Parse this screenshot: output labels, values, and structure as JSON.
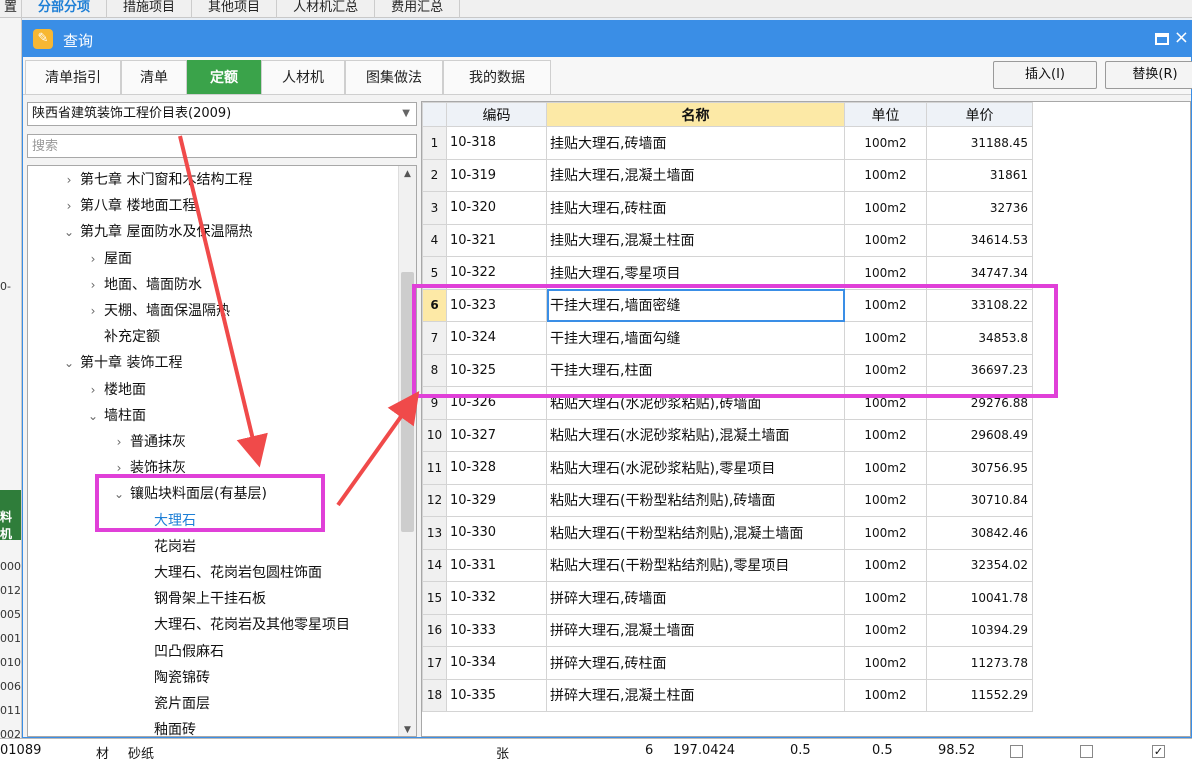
{
  "background": {
    "tabs": [
      "置",
      "分部分项",
      "措施项目",
      "其他项目",
      "人材机汇总",
      "费用汇总"
    ],
    "left_cells": [
      "0-",
      "料机",
      "000",
      "012",
      "005",
      "001",
      "010",
      "006",
      "011",
      "002"
    ],
    "bottom_row": {
      "code": "01089",
      "type": "材",
      "name": "砂纸",
      "unit": "张",
      "qty": "6",
      "price": "197.0424",
      "v1": "0.5",
      "v2": "0.5",
      "v3": "98.52"
    }
  },
  "dialog": {
    "title": "查询",
    "tabs": [
      "清单指引",
      "清单",
      "定额",
      "人材机",
      "图集做法",
      "我的数据"
    ],
    "active_tab": "定额",
    "insert_button": "插入(I)",
    "replace_button": "替换(R)"
  },
  "library": {
    "selected": "陕西省建筑装饰工程价目表(2009)",
    "search_placeholder": "搜索"
  },
  "tree": [
    {
      "label": "第七章 木门窗和木结构工程",
      "level": 1,
      "arrow": "›"
    },
    {
      "label": "第八章 楼地面工程",
      "level": 1,
      "arrow": "›"
    },
    {
      "label": "第九章 屋面防水及保温隔热",
      "level": 1,
      "arrow": "⌄"
    },
    {
      "label": "屋面",
      "level": 2,
      "arrow": "›"
    },
    {
      "label": "地面、墙面防水",
      "level": 2,
      "arrow": "›"
    },
    {
      "label": "天棚、墙面保温隔热",
      "level": 2,
      "arrow": "›"
    },
    {
      "label": "补充定额",
      "level": 2,
      "arrow": ""
    },
    {
      "label": "第十章 装饰工程",
      "level": 1,
      "arrow": "⌄"
    },
    {
      "label": "楼地面",
      "level": 2,
      "arrow": "›"
    },
    {
      "label": "墙柱面",
      "level": 2,
      "arrow": "⌄"
    },
    {
      "label": "普通抹灰",
      "level": 3,
      "arrow": "›"
    },
    {
      "label": "装饰抹灰",
      "level": 3,
      "arrow": "›"
    },
    {
      "label": "镶贴块料面层(有基层)",
      "level": 3,
      "arrow": "⌄"
    },
    {
      "label": "大理石",
      "level": 4,
      "arrow": "",
      "selected": true
    },
    {
      "label": "花岗岩",
      "level": 4,
      "arrow": ""
    },
    {
      "label": "大理石、花岗岩包圆柱饰面",
      "level": 4,
      "arrow": ""
    },
    {
      "label": "钢骨架上干挂石板",
      "level": 4,
      "arrow": ""
    },
    {
      "label": "大理石、花岗岩及其他零星项目",
      "level": 4,
      "arrow": ""
    },
    {
      "label": "凹凸假麻石",
      "level": 4,
      "arrow": ""
    },
    {
      "label": "陶瓷锦砖",
      "level": 4,
      "arrow": ""
    },
    {
      "label": "瓷片面层",
      "level": 4,
      "arrow": ""
    },
    {
      "label": "釉面砖",
      "level": 4,
      "arrow": ""
    }
  ],
  "grid": {
    "headers": [
      "编码",
      "名称",
      "单位",
      "单价"
    ],
    "current_row": 6,
    "rows": [
      {
        "n": "1",
        "code": "10-318",
        "name": "挂贴大理石,砖墙面",
        "unit": "100m2",
        "price": "31188.45"
      },
      {
        "n": "2",
        "code": "10-319",
        "name": "挂贴大理石,混凝土墙面",
        "unit": "100m2",
        "price": "31861"
      },
      {
        "n": "3",
        "code": "10-320",
        "name": "挂贴大理石,砖柱面",
        "unit": "100m2",
        "price": "32736"
      },
      {
        "n": "4",
        "code": "10-321",
        "name": "挂贴大理石,混凝土柱面",
        "unit": "100m2",
        "price": "34614.53"
      },
      {
        "n": "5",
        "code": "10-322",
        "name": "挂贴大理石,零星项目",
        "unit": "100m2",
        "price": "34747.34"
      },
      {
        "n": "6",
        "code": "10-323",
        "name": "干挂大理石,墙面密缝",
        "unit": "100m2",
        "price": "33108.22"
      },
      {
        "n": "7",
        "code": "10-324",
        "name": "干挂大理石,墙面勾缝",
        "unit": "100m2",
        "price": "34853.8"
      },
      {
        "n": "8",
        "code": "10-325",
        "name": "干挂大理石,柱面",
        "unit": "100m2",
        "price": "36697.23"
      },
      {
        "n": "9",
        "code": "10-326",
        "name": "粘贴大理石(水泥砂浆粘贴),砖墙面",
        "unit": "100m2",
        "price": "29276.88"
      },
      {
        "n": "10",
        "code": "10-327",
        "name": "粘贴大理石(水泥砂浆粘贴),混凝土墙面",
        "unit": "100m2",
        "price": "29608.49"
      },
      {
        "n": "11",
        "code": "10-328",
        "name": "粘贴大理石(水泥砂浆粘贴),零星项目",
        "unit": "100m2",
        "price": "30756.95"
      },
      {
        "n": "12",
        "code": "10-329",
        "name": "粘贴大理石(干粉型粘结剂贴),砖墙面",
        "unit": "100m2",
        "price": "30710.84"
      },
      {
        "n": "13",
        "code": "10-330",
        "name": "粘贴大理石(干粉型粘结剂贴),混凝土墙面",
        "unit": "100m2",
        "price": "30842.46"
      },
      {
        "n": "14",
        "code": "10-331",
        "name": "粘贴大理石(干粉型粘结剂贴),零星项目",
        "unit": "100m2",
        "price": "32354.02"
      },
      {
        "n": "15",
        "code": "10-332",
        "name": "拼碎大理石,砖墙面",
        "unit": "100m2",
        "price": "10041.78"
      },
      {
        "n": "16",
        "code": "10-333",
        "name": "拼碎大理石,混凝土墙面",
        "unit": "100m2",
        "price": "10394.29"
      },
      {
        "n": "17",
        "code": "10-334",
        "name": "拼碎大理石,砖柱面",
        "unit": "100m2",
        "price": "11273.78"
      },
      {
        "n": "18",
        "code": "10-335",
        "name": "拼碎大理石,混凝土柱面",
        "unit": "100m2",
        "price": "11552.29"
      }
    ]
  },
  "colors": {
    "accent": "#3a8ee6",
    "active_tab": "#3aa34a",
    "annotation": "#e040d8",
    "arrow": "#f04a4a"
  }
}
